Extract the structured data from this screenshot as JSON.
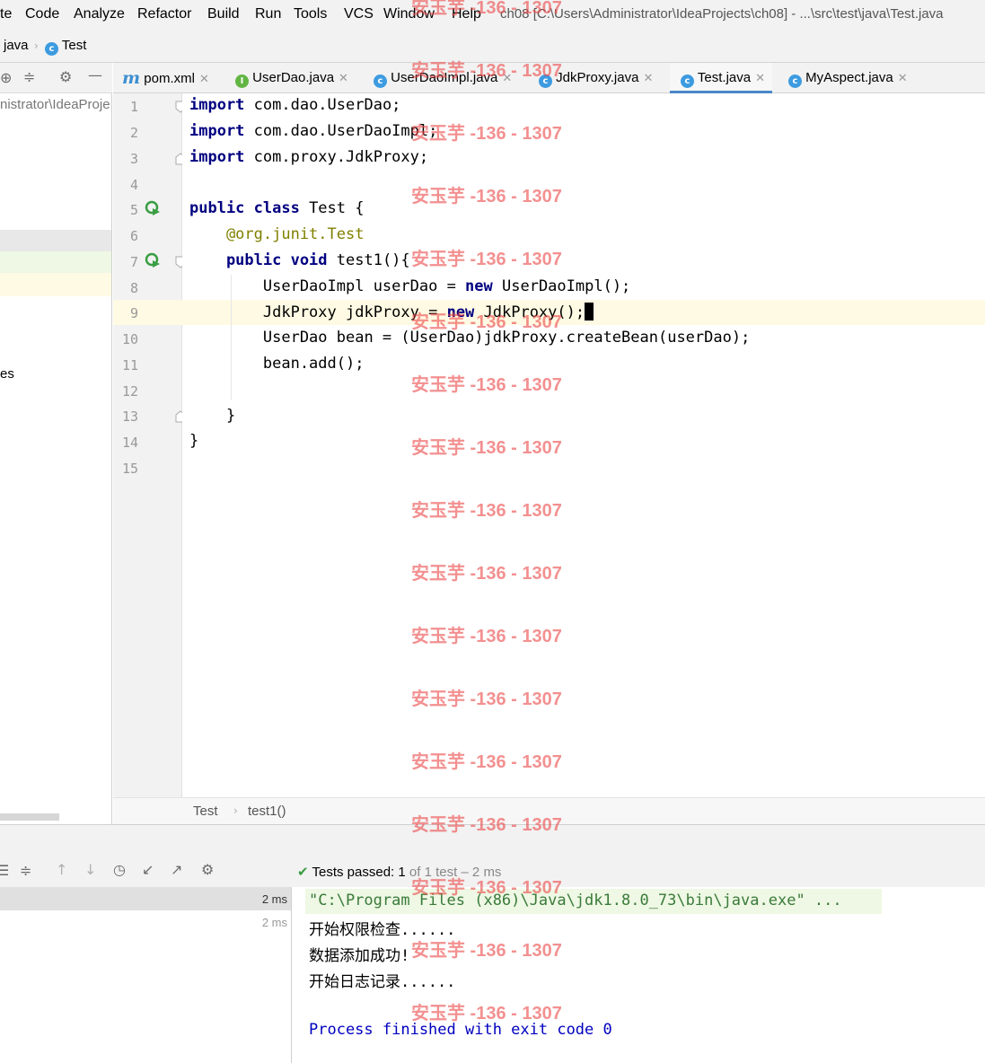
{
  "menu": {
    "items": [
      "te",
      "Code",
      "Analyze",
      "Refactor",
      "Build",
      "Run",
      "Tools",
      "VCS",
      "Window",
      "Help"
    ],
    "window_title": "ch08 [C:\\Users\\Administrator\\IdeaProjects\\ch08] - ...\\src\\test\\java\\Test.java"
  },
  "nav": {
    "crumbs": [
      "java",
      "Test"
    ]
  },
  "project": {
    "path_fragment": "nistrator\\IdeaProje",
    "item_fragment": "es"
  },
  "tabs": [
    {
      "label": "pom.xml",
      "icon": "maven-icon"
    },
    {
      "label": "UserDao.java",
      "icon": "interface-icon"
    },
    {
      "label": "UserDaoImpl.java",
      "icon": "class-icon"
    },
    {
      "label": "JdkProxy.java",
      "icon": "class-icon"
    },
    {
      "label": "Test.java",
      "icon": "class-icon",
      "active": true
    },
    {
      "label": "MyAspect.java",
      "icon": "class-icon"
    }
  ],
  "editor": {
    "line_numbers": [
      "1",
      "2",
      "3",
      "4",
      "5",
      "6",
      "7",
      "8",
      "9",
      "10",
      "11",
      "12",
      "13",
      "14",
      "15"
    ],
    "lines": [
      {
        "kw": "import",
        "rest": " com.dao.UserDao;"
      },
      {
        "kw": "import",
        "rest": " com.dao.UserDaoImpl;"
      },
      {
        "kw": "import",
        "rest": " com.proxy.JdkProxy;"
      },
      {
        "kw": "",
        "rest": ""
      },
      {
        "kw": "public class",
        "rest": " Test {"
      },
      {
        "ann_prefix": "    @org.junit.",
        "ann_name": "Test"
      },
      {
        "kw": "    public void",
        "rest": " test1(){"
      },
      {
        "pre": "        UserDaoImpl userDao = ",
        "kw": "new",
        "rest": " UserDaoImpl();"
      },
      {
        "pre": "        JdkProxy jdkProxy = ",
        "kw": "new",
        "rest": " JdkProxy();"
      },
      {
        "rest": "        UserDao bean = (UserDao)jdkProxy.createBean(userDao);"
      },
      {
        "rest": "        bean.add();"
      },
      {
        "rest": ""
      },
      {
        "rest": "    }"
      },
      {
        "rest": "}"
      },
      {
        "rest": ""
      }
    ],
    "breadcrumb": [
      "Test",
      "test1()"
    ]
  },
  "run": {
    "status": "Tests passed: 1 of 1 test – 2 ms",
    "status_main": "Tests passed: 1",
    "status_rest": "of 1 test – 2 ms",
    "tree_times": [
      "2 ms",
      "2 ms"
    ],
    "console": [
      "\"C:\\Program Files (x86)\\Java\\jdk1.8.0_73\\bin\\java.exe\" ...",
      "开始权限检查......",
      "数据添加成功!",
      "开始日志记录......",
      "",
      "Process finished with exit code 0"
    ]
  },
  "watermark": "安玉芋 -136 - 1307",
  "colors": {
    "keyword": "#000080",
    "annotation": "#808000",
    "caret_line": "#fffae3",
    "pass_green": "#3a9d43",
    "exit_blue": "#0000c0",
    "watermark": "#eb4646"
  }
}
